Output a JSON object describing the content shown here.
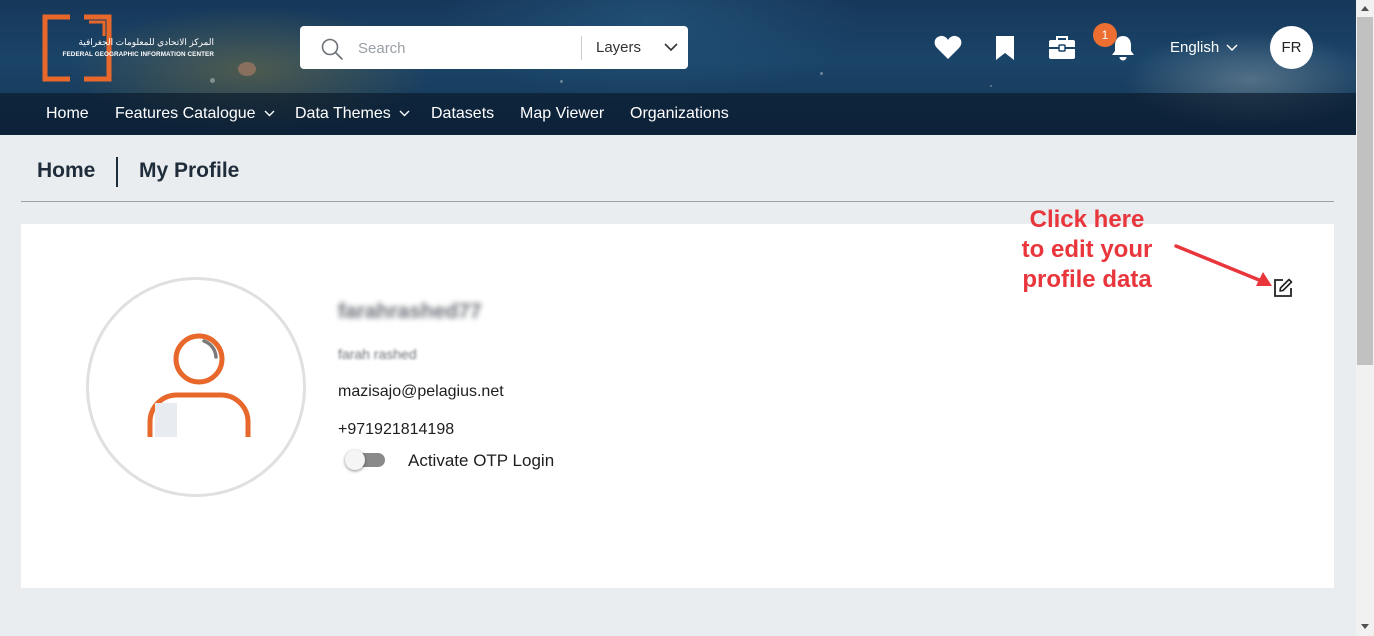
{
  "brand": {
    "logo_arabic": "المركز الاتحادي للمعلومات الجغرافية",
    "logo_english": "FEDERAL GEOGRAPHIC INFORMATION CENTER",
    "accent_color": "#ec6f31"
  },
  "search": {
    "placeholder": "Search",
    "scope_selected": "Layers"
  },
  "header_icons": [
    "heart-icon",
    "bookmark-icon",
    "toolbox-icon",
    "bell-icon"
  ],
  "notifications": {
    "count": "1"
  },
  "language": {
    "selected": "English"
  },
  "user": {
    "initials": "FR"
  },
  "nav": {
    "items": [
      {
        "label": "Home"
      },
      {
        "label": "Features Catalogue",
        "dropdown": true
      },
      {
        "label": "Data Themes",
        "dropdown": true
      },
      {
        "label": "Datasets"
      },
      {
        "label": "Map Viewer"
      },
      {
        "label": "Organizations"
      }
    ]
  },
  "breadcrumb": {
    "home": "Home",
    "current": "My Profile"
  },
  "profile": {
    "username": "farahrashed77",
    "full_name": "farah rashed",
    "email": "mazisajo@pelagius.net",
    "phone": "+971921814198",
    "otp_label": "Activate OTP Login",
    "otp_enabled": false
  },
  "annotation": {
    "line1": "Click here",
    "line2": "to edit your",
    "line3": "profile data",
    "color": "#e8363c"
  }
}
